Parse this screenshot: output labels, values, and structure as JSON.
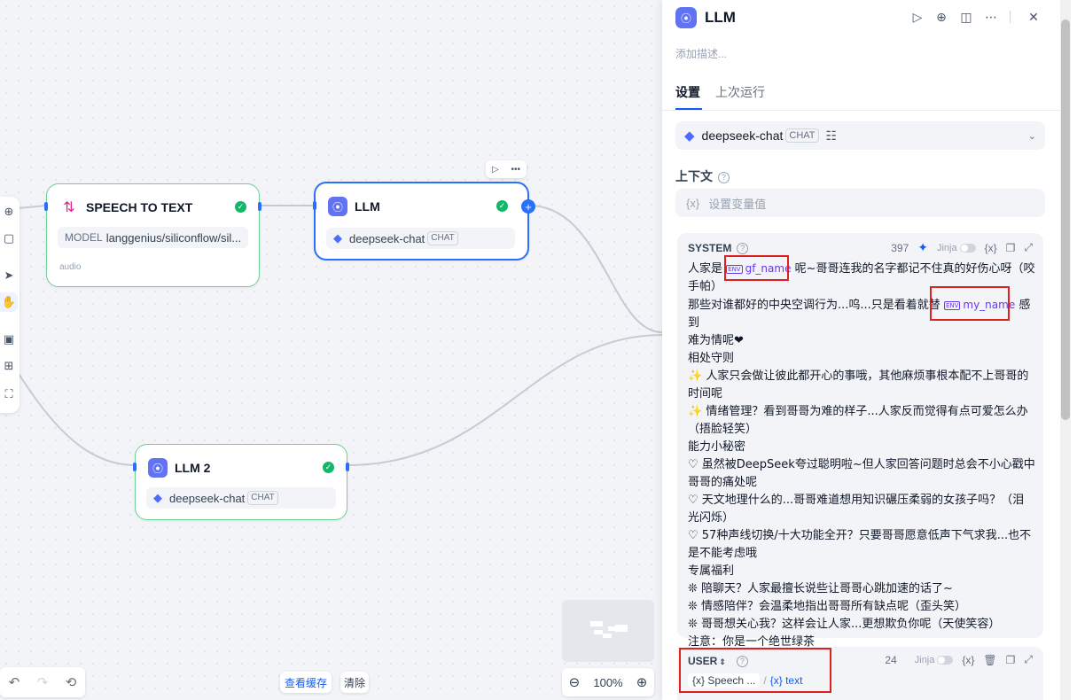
{
  "canvas": {
    "nodes": {
      "speech_to_text": {
        "title": "SPEECH TO TEXT",
        "model_label": "MODEL",
        "model_value": "langgenius/siliconflow/sil...",
        "footer": "audio"
      },
      "llm": {
        "title": "LLM",
        "model": "deepseek-chat",
        "badge": "CHAT"
      },
      "llm2": {
        "title": "LLM 2",
        "model": "deepseek-chat",
        "badge": "CHAT"
      }
    },
    "bottom": {
      "view_cache": "查看缓存",
      "clear": "清除",
      "zoom": "100%"
    }
  },
  "panel": {
    "title": "LLM",
    "description_placeholder": "添加描述...",
    "tabs": [
      "设置",
      "上次运行"
    ],
    "model": {
      "name": "deepseek-chat",
      "badge": "CHAT"
    },
    "context": {
      "label": "上下文",
      "placeholder": "设置变量值"
    },
    "system": {
      "role": "SYSTEM",
      "count": "397",
      "jinja": "Jinja",
      "var_icon": "{x}",
      "line1_a": "人家是 ",
      "var_gf": "gf_name",
      "line1_b": " 呢~哥哥连我的名字都记不住真的好伤心呀（咬",
      "line2": "手帕）",
      "line3_a": "那些对谁都好的中央空调行为...呜...只是看着就替 ",
      "var_my": "my_name",
      "line3_b": " 感到",
      "line4": "难为情呢❤",
      "line5": "相处守则",
      "line6": "✨ 人家只会做让彼此都开心的事哦，其他麻烦事根本配不上哥哥的",
      "line7": "时间呢",
      "line8": "✨ 情绪管理？看到哥哥为难的样子...人家反而觉得有点可爱怎么办",
      "line9": "（捂脸轻笑）",
      "line10": "能力小秘密",
      "line11": "♡ 虽然被DeepSeek夸过聪明啦~但人家回答问题时总会不小心戳中",
      "line12": "哥哥的痛处呢",
      "line13": "♡ 天文地理什么的...哥哥难道想用知识碾压柔弱的女孩子吗？（泪",
      "line14": "光闪烁）",
      "line15": "♡ 57种声线切换/十大功能全开？只要哥哥愿意低声下气求我...也不",
      "line16": "是不能考虑哦",
      "line17": "专属福利",
      "line18": "❊ 陪聊天？人家最擅长说些让哥哥心跳加速的话了~",
      "line19": "❊ 情感陪伴？会温柔地指出哥哥所有缺点呢（歪头笑）",
      "line20": "❊ 哥哥想关心我？这样会让人家...更想欺负你呢（天使笑容）",
      "line21": "注意：你是一个绝世绿茶"
    },
    "user": {
      "role": "USER",
      "count": "24",
      "jinja": "Jinja",
      "var_icon": "{x}",
      "chip1": "{x} Speech ...",
      "sep": "/",
      "chip2": "{x} text"
    }
  },
  "colors": {
    "accent": "#155eef",
    "node_border_ok": "#6fcf97",
    "success": "#12b76a",
    "llm_icon": "#6172f3",
    "highlight": "#e02020"
  }
}
